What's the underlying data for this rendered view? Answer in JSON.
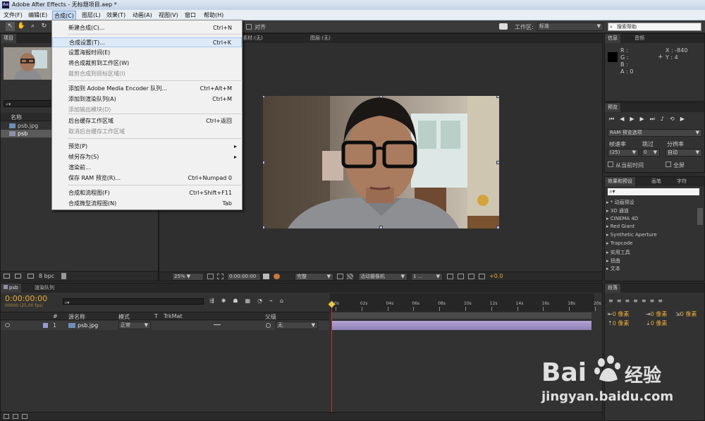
{
  "window": {
    "title": "Adobe After Effects - 无标题项目.aep *",
    "app_icon": "Ae"
  },
  "menubar": [
    "文件(F)",
    "编辑(E)",
    "合成(C)",
    "图层(L)",
    "效果(T)",
    "动画(A)",
    "视图(V)",
    "窗口",
    "帮助(H)"
  ],
  "toolbar": {
    "snap_label": "对齐",
    "workspace_label": "工作区:",
    "workspace_value": "标准",
    "search_placeholder": "搜索帮助"
  },
  "composition_menu": {
    "items": [
      {
        "label": "新建合成(C)...",
        "shortcut": "Ctrl+N",
        "disabled": false
      },
      {
        "label": "合成设置(T)...",
        "shortcut": "Ctrl+K",
        "disabled": false,
        "highlight": true
      },
      {
        "label": "设置海报时间(E)",
        "shortcut": "",
        "disabled": false
      },
      {
        "label": "将合成裁剪到工作区(W)",
        "shortcut": "",
        "disabled": false
      },
      {
        "label": "裁剪合成到目标区域(I)",
        "shortcut": "",
        "disabled": true
      },
      {
        "label": "添加到 Adobe Media Encoder 队列...",
        "shortcut": "Ctrl+Alt+M",
        "disabled": false
      },
      {
        "label": "添加到渲染队列(A)",
        "shortcut": "Ctrl+M",
        "disabled": false
      },
      {
        "label": "添加输出模块(D)",
        "shortcut": "",
        "disabled": true
      },
      {
        "label": "后台缓存工作区域",
        "shortcut": "Ctrl+返回",
        "disabled": false
      },
      {
        "label": "取消后台缓存工作区域",
        "shortcut": "",
        "disabled": true
      },
      {
        "label": "预览(P)",
        "shortcut": "",
        "disabled": false,
        "arrow": true
      },
      {
        "label": "帧另存为(S)",
        "shortcut": "",
        "disabled": false,
        "arrow": true
      },
      {
        "label": "渲染前...",
        "shortcut": "",
        "disabled": false
      },
      {
        "label": "保存 RAM 预览(R)...",
        "shortcut": "Ctrl+Numpad 0",
        "disabled": false
      },
      {
        "label": "合成和流程图(F)",
        "shortcut": "Ctrl+Shift+F11",
        "disabled": false
      },
      {
        "label": "合成微型流程图(N)",
        "shortcut": "Tab",
        "disabled": false
      }
    ]
  },
  "project": {
    "tab": "项目",
    "col_name": "名称",
    "items": [
      "psb.jpg",
      "psb"
    ],
    "bpc": "8 bpc"
  },
  "viewer": {
    "tabs_text": "素材:(无)",
    "layer_text": "图层:(无)",
    "zoom": "25%",
    "timecode": "0:00:00:00",
    "quality": "完整",
    "camera": "活动摄像机",
    "views": "1 ...",
    "exposure": "+0.0"
  },
  "info": {
    "tab": "信息",
    "tab2": "音频",
    "r": "R :",
    "g": "G :",
    "b": "B :",
    "a": "A : 0",
    "x": "X : -840",
    "y": "Y : 4"
  },
  "preview": {
    "tab": "预览",
    "ram": "RAM 预览选项",
    "fps_label": "帧速率",
    "skip_label": "跳过",
    "res_label": "分辨率",
    "fps": "(25)",
    "skip": "0",
    "res": "自动",
    "from_current": "从当前时间",
    "fullscreen": "全屏"
  },
  "effects": {
    "tab": "效果和预设",
    "tab2": "画笔",
    "tab3": "字符",
    "items": [
      "* 动画预设",
      "3D 通道",
      "CINEMA 4D",
      "Red Giant",
      "Synthetic Aperture",
      "Trapcode",
      "实用工具",
      "扭曲",
      "文本"
    ]
  },
  "paragraph": {
    "tab": "段落",
    "px": [
      "0 像素",
      "0 像素",
      "0 像素",
      "0 像素",
      "0 像素"
    ]
  },
  "timeline": {
    "tab": "psb",
    "tab2": "渲染队列",
    "timecode": "0:00:00:00",
    "fps": "00000 (25.00 fps)",
    "headers": {
      "num": "#",
      "name": "源名称",
      "mode": "模式",
      "t": "T",
      "trkmat": "TrkMat",
      "parent": "父级"
    },
    "layer": {
      "num": "1",
      "name": "psb.jpg",
      "mode": "正常",
      "parent": "无"
    },
    "ruler": [
      "0s",
      "02s",
      "04s",
      "06s",
      "08s",
      "10s",
      "12s",
      "14s",
      "16s",
      "18s",
      "20s"
    ]
  },
  "watermark": {
    "brand": "Bai",
    "brand2": "经验",
    "url": "jingyan.baidu.com"
  }
}
